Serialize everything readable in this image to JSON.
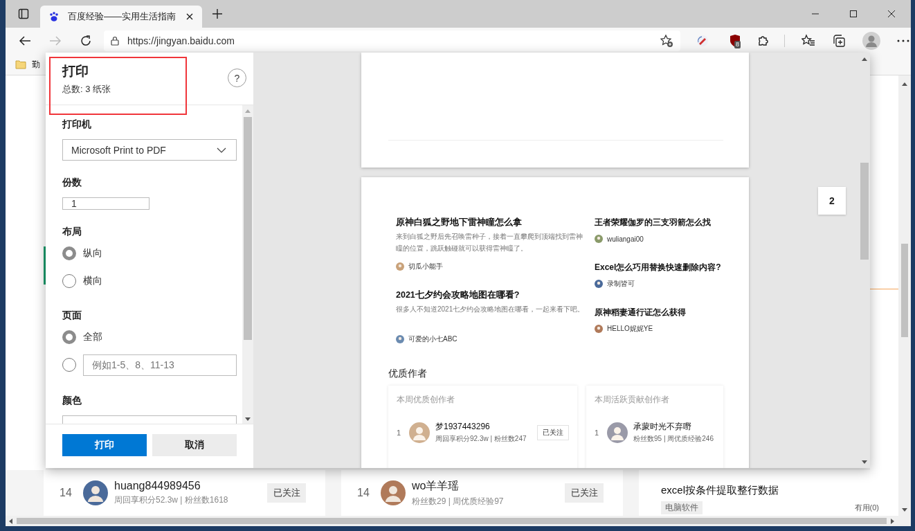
{
  "browser": {
    "tab_title": "百度经验——实用生活指南",
    "url": "https://jingyan.baidu.com",
    "extension_badge": "8",
    "bookmark": "勤"
  },
  "print_dialog": {
    "title": "打印",
    "summary": "总数: 3 纸张",
    "help": "?",
    "printer": {
      "label": "打印机",
      "value": "Microsoft Print to PDF"
    },
    "copies": {
      "label": "份数",
      "value": "1"
    },
    "layout": {
      "label": "布局",
      "options": [
        {
          "label": "纵向",
          "selected": true
        },
        {
          "label": "横向",
          "selected": false
        }
      ]
    },
    "pages": {
      "label": "页面",
      "options": [
        {
          "kind": "all",
          "label": "全部",
          "selected": true
        },
        {
          "kind": "range",
          "placeholder": "例如1-5、8、11-13",
          "selected": false
        }
      ]
    },
    "color": {
      "label": "颜色"
    },
    "buttons": [
      {
        "kind": "primary",
        "label": "打印"
      },
      {
        "kind": "secondary",
        "label": "取消"
      }
    ]
  },
  "preview": {
    "page_number": "2",
    "columns": [
      {
        "articles": [
          {
            "title": "原神白狐之野地下雷神瞳怎么拿",
            "summary": "来到白狐之野后先召唤雷种子，接着一直攀爬到顶端找到雷神瞳的位置，跳跃触碰就可以获得雷神瞳了。",
            "author": "切瓜小能手"
          },
          {
            "title": "2021七夕约会攻略地图在哪看?",
            "summary": "很多人不知道2021七夕约会攻略地图在哪看，一起来看下吧。",
            "author": "可爱的小七ABC"
          }
        ]
      },
      {
        "articles": [
          {
            "title": "王者荣耀伽罗的三支羽箭怎么找",
            "author": "wuliangai00"
          },
          {
            "title": "Excel怎么巧用替换快速删除内容?",
            "author": "录制皆可"
          },
          {
            "title": "原神稻妻通行证怎么获得",
            "author": "HELLO妮妮YE"
          }
        ]
      }
    ],
    "authors_heading": "优质作者",
    "author_cards": [
      {
        "title": "本周优质创作者",
        "rows": [
          {
            "rank": "1",
            "name": "梦1937443296",
            "stats": "周回享积分92.3w | 粉丝数247",
            "button": "已关注"
          }
        ]
      },
      {
        "title": "本周活跃贡献创作者",
        "rows": [
          {
            "rank": "1",
            "name": "承蒙时光不弃嘢",
            "stats": "粉丝数95 | 周优质经验246"
          }
        ]
      }
    ]
  },
  "background_page": {
    "authors": [
      {
        "rank": "14",
        "name": "huang844989456",
        "stats": "周回享积分52.3w | 粉丝数1618",
        "button": "已关注"
      },
      {
        "rank": "14",
        "name": "wo羊羊瑶",
        "stats": "粉丝数29 | 周优质经验97",
        "button": "已关注"
      }
    ],
    "article": {
      "title": "excel按条件提取整行数据",
      "tag": "电脑软件",
      "useful": "有用(0)"
    }
  }
}
